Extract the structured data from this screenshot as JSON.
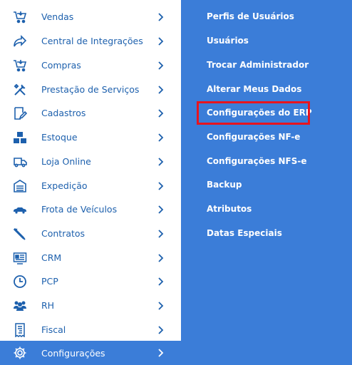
{
  "menu": {
    "items": [
      {
        "label": "Vendas",
        "icon": "cart-download-icon"
      },
      {
        "label": "Central de Integrações",
        "icon": "share-arrow-icon"
      },
      {
        "label": "Compras",
        "icon": "cart-download-icon"
      },
      {
        "label": "Prestação de Serviços",
        "icon": "tools-icon"
      },
      {
        "label": "Cadastros",
        "icon": "edit-document-icon"
      },
      {
        "label": "Estoque",
        "icon": "boxes-icon"
      },
      {
        "label": "Loja Online",
        "icon": "delivery-truck-icon"
      },
      {
        "label": "Expedição",
        "icon": "warehouse-icon"
      },
      {
        "label": "Frota de Veículos",
        "icon": "car-icon"
      },
      {
        "label": "Contratos",
        "icon": "pen-icon"
      },
      {
        "label": "CRM",
        "icon": "id-card-icon"
      },
      {
        "label": "PCP",
        "icon": "clock-icon"
      },
      {
        "label": "RH",
        "icon": "people-icon"
      },
      {
        "label": "Fiscal",
        "icon": "receipt-icon"
      },
      {
        "label": "Configurações",
        "icon": "gear-icon"
      }
    ],
    "active": "Configurações"
  },
  "submenu": {
    "items": [
      "Perfis de Usuários",
      "Usuários",
      "Trocar Administrador",
      "Alterar Meus Dados",
      "Configurações do ERP",
      "Configurações NF-e",
      "Configurações NFS-e",
      "Backup",
      "Atributos",
      "Datas Especiais"
    ],
    "highlighted": "Configurações do ERP"
  },
  "colors": {
    "menu_text": "#1d60ad",
    "panel_bg": "#3b7dd8",
    "highlight_border": "#e8141e"
  }
}
